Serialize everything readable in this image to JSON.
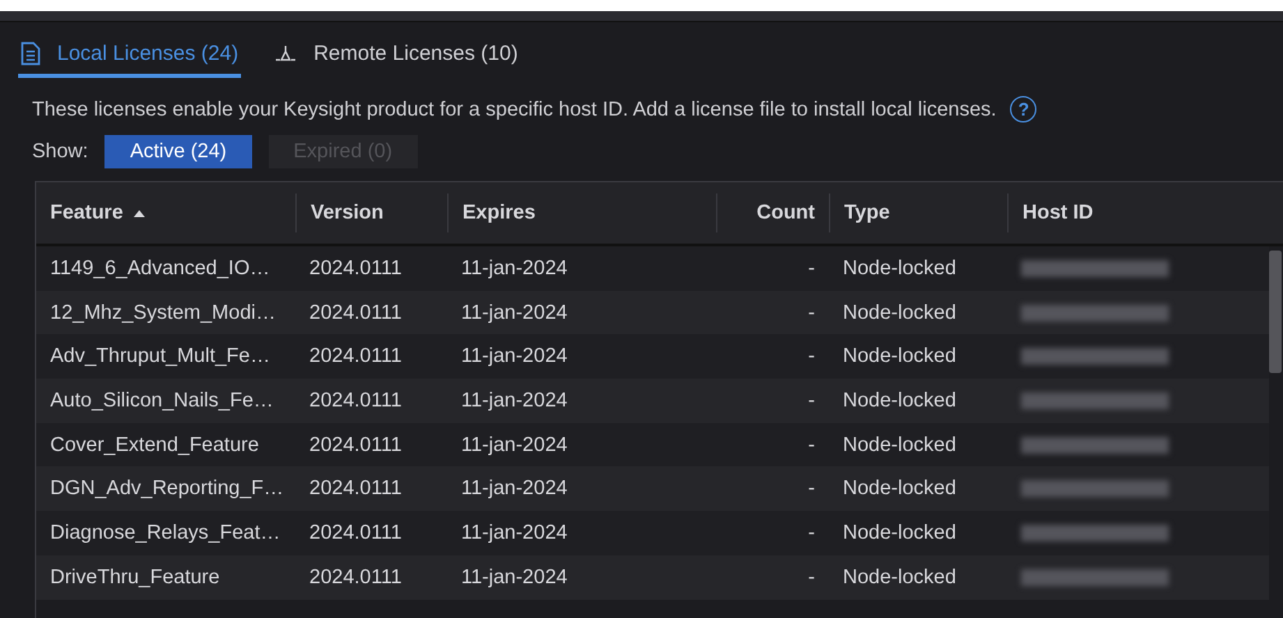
{
  "tabs": [
    {
      "label": "Local Licenses (24)",
      "kind": "document",
      "selected": true
    },
    {
      "label": "Remote Licenses (10)",
      "kind": "network",
      "selected": false
    }
  ],
  "description": "These licenses enable your Keysight product for a specific host ID. Add a license file to install local licenses.",
  "help": "?",
  "filter": {
    "label": "Show:",
    "options": [
      {
        "label": "Active (24)",
        "selected": true
      },
      {
        "label": "Expired (0)",
        "selected": false
      }
    ]
  },
  "table": {
    "columns": [
      {
        "label": "Feature",
        "sorted": true,
        "numeric": false
      },
      {
        "label": "Version",
        "sorted": false,
        "numeric": false
      },
      {
        "label": "Expires",
        "sorted": false,
        "numeric": false
      },
      {
        "label": "Count",
        "sorted": false,
        "numeric": true
      },
      {
        "label": "Type",
        "sorted": false,
        "numeric": false
      },
      {
        "label": "Host ID",
        "sorted": false,
        "numeric": false,
        "redacted": true
      }
    ],
    "rows": [
      [
        "1149_6_Advanced_IO…",
        "2024.0111",
        "11-jan-2024",
        "-",
        "Node-locked"
      ],
      [
        "12_Mhz_System_Modi…",
        "2024.0111",
        "11-jan-2024",
        "-",
        "Node-locked"
      ],
      [
        "Adv_Thruput_Mult_Fe…",
        "2024.0111",
        "11-jan-2024",
        "-",
        "Node-locked"
      ],
      [
        "Auto_Silicon_Nails_Fe…",
        "2024.0111",
        "11-jan-2024",
        "-",
        "Node-locked"
      ],
      [
        "Cover_Extend_Feature",
        "2024.0111",
        "11-jan-2024",
        "-",
        "Node-locked"
      ],
      [
        "DGN_Adv_Reporting_F…",
        "2024.0111",
        "11-jan-2024",
        "-",
        "Node-locked"
      ],
      [
        "Diagnose_Relays_Feat…",
        "2024.0111",
        "11-jan-2024",
        "-",
        "Node-locked"
      ],
      [
        "DriveThru_Feature",
        "2024.0111",
        "11-jan-2024",
        "-",
        "Node-locked"
      ]
    ]
  }
}
